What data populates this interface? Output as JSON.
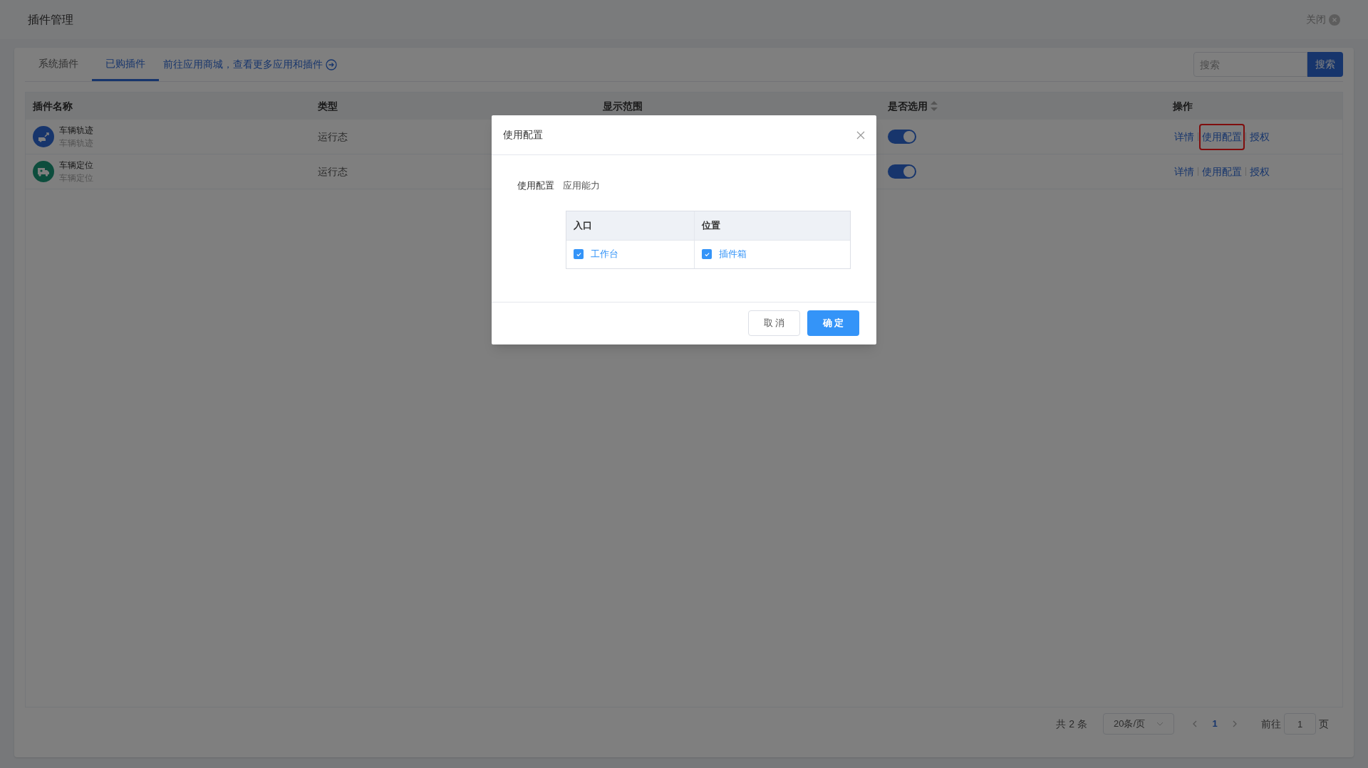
{
  "header": {
    "title": "插件管理",
    "close_label": "关闭"
  },
  "tabs": [
    {
      "label": "系统插件",
      "selected": false
    },
    {
      "label": "已购插件",
      "selected": true
    }
  ],
  "store_link": "前往应用商城，查看更多应用和插件",
  "search": {
    "placeholder": "搜索",
    "button": "搜索"
  },
  "table": {
    "columns": [
      {
        "label": "插件名称",
        "sortable": false
      },
      {
        "label": "类型",
        "sortable": false
      },
      {
        "label": "显示范围",
        "sortable": false
      },
      {
        "label": "是否选用",
        "sortable": true
      },
      {
        "label": "操作",
        "sortable": false
      }
    ],
    "rows": [
      {
        "name": "车辆轨迹",
        "subtitle": "车辆轨迹",
        "kind": "route",
        "type": "运行态",
        "enabled": true,
        "actions": [
          {
            "label": "详情",
            "highlighted": false
          },
          {
            "label": "使用配置",
            "highlighted": true
          },
          {
            "label": "授权",
            "highlighted": false
          }
        ]
      },
      {
        "name": "车辆定位",
        "subtitle": "车辆定位",
        "kind": "truck",
        "type": "运行态",
        "enabled": true,
        "actions": [
          {
            "label": "详情",
            "highlighted": false
          },
          {
            "label": "使用配置",
            "highlighted": false
          },
          {
            "label": "授权",
            "highlighted": false
          }
        ]
      }
    ]
  },
  "pagination": {
    "total": "共 2 条",
    "page_size": "20条/页",
    "pages": [
      {
        "label": "1",
        "selected": true
      }
    ],
    "goto_label": "前往",
    "goto_value": "1",
    "page_suffix": "页"
  },
  "dialog": {
    "title": "使用配置",
    "field_label": "使用配置",
    "field_value": "应用能力",
    "columns": [
      "入口",
      "位置"
    ],
    "rows": [
      [
        {
          "label": "工作台",
          "checked": true
        },
        {
          "label": "插件箱",
          "checked": true
        }
      ]
    ],
    "buttons": [
      {
        "label": "取 消",
        "kind": "secondary"
      },
      {
        "label": "确 定",
        "kind": "primary"
      }
    ]
  }
}
